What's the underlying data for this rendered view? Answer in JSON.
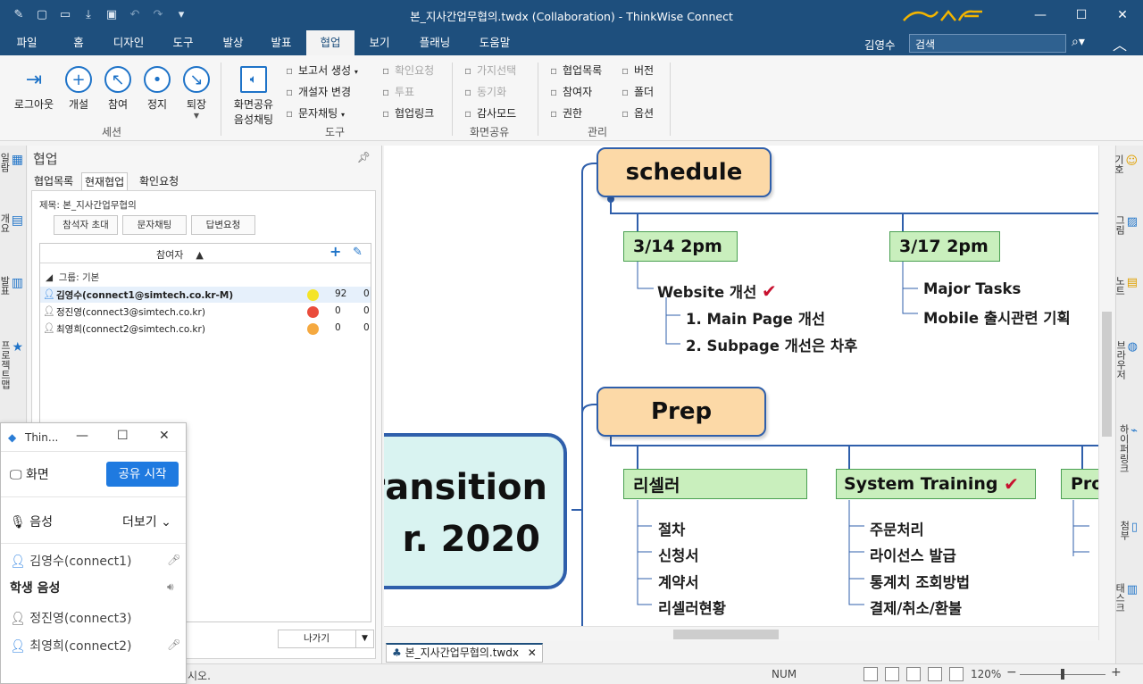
{
  "window": {
    "title": "본_지사간업무협의.twdx (Collaboration) - ThinkWise Connect",
    "minimize": "—",
    "maximize": "☐",
    "close": "✕"
  },
  "menu": {
    "tabs": [
      "파일",
      "홈",
      "디자인",
      "도구",
      "발상",
      "발표",
      "협업",
      "보기",
      "플래닝",
      "도움말"
    ],
    "active": "협업",
    "user": "김영수",
    "search_placeholder": "검색"
  },
  "ribbon": {
    "session": {
      "label": "세션",
      "buttons": [
        "로그아웃",
        "개설",
        "참여",
        "정지",
        "퇴장"
      ]
    },
    "tools": {
      "label": "도구",
      "screen_share_1": "화면공유",
      "screen_share_2": "음성채팅",
      "items": [
        {
          "text": "보고서 생성",
          "enabled": true,
          "dropdown": true
        },
        {
          "text": "개설자 변경",
          "enabled": true
        },
        {
          "text": "문자채팅",
          "enabled": true,
          "dropdown": true
        },
        {
          "text": "확인요청",
          "enabled": false
        },
        {
          "text": "투표",
          "enabled": false
        },
        {
          "text": "협업링크",
          "enabled": true
        }
      ]
    },
    "screenshare": {
      "label": "화면공유",
      "items": [
        {
          "text": "가지선택",
          "enabled": false
        },
        {
          "text": "동기화",
          "enabled": false
        },
        {
          "text": "감사모드",
          "enabled": true
        }
      ]
    },
    "manage": {
      "label": "관리",
      "items": [
        "협업목록",
        "참여자",
        "권한",
        "버전",
        "폴더",
        "옵션"
      ]
    }
  },
  "left_rail": [
    "일람",
    "개요",
    "발표",
    "프로젝트맵"
  ],
  "panel": {
    "title": "협업",
    "tabs": [
      "협업목록",
      "현재협업",
      "확인요청"
    ],
    "active_tab": "현재협업",
    "subject": "제목: 본_지사간업무협의",
    "buttons": [
      "참석자 초대",
      "문자채팅",
      "답변요청"
    ],
    "grid_header": "참여자",
    "group": "그룹: 기본",
    "participants": [
      {
        "name": "김영수(connect1@simtech.co.kr-M)",
        "status_color": "#f4e427",
        "v1": "92",
        "v2": "0",
        "bold": true
      },
      {
        "name": "정진영(connect3@simtech.co.kr)",
        "status_color": "#ea4c3c",
        "v1": "0",
        "v2": "0",
        "bold": false
      },
      {
        "name": "최영희(connect2@simtech.co.kr)",
        "status_color": "#f5a940",
        "v1": "0",
        "v2": "0",
        "bold": false
      }
    ],
    "exit_button": "나가기"
  },
  "mini_window": {
    "title": "Thin...",
    "screen_label": "화면",
    "share_button": "공유 시작",
    "voice_label": "음성",
    "more_label": "더보기",
    "users": [
      {
        "name": "김영수(connect1)",
        "color": "#1f7ae0"
      },
      {
        "name": "정진영(connect3)",
        "color": "#555555"
      },
      {
        "name": "최영희(connect2)",
        "color": "#1f7ae0"
      }
    ],
    "student_voice": "학생 음성"
  },
  "map": {
    "central_line1": "Transition",
    "central_line2": "r. 2020",
    "topic1": "schedule",
    "topic1_sub1": "3/14 2pm",
    "topic1_sub1_leaf": "Website 개선",
    "topic1_sub1_children": [
      "1. Main Page 개선",
      "2. Subpage 개선은 차후"
    ],
    "topic1_sub2": "3/17 2pm",
    "topic1_sub2_leaves": [
      "Major Tasks",
      "Mobile 출시관련 기획"
    ],
    "topic2": "Prep",
    "topic2_sub1": "리셀러",
    "topic2_sub1_leaves": [
      "절차",
      "신청서",
      "계약서",
      "리셀러현황"
    ],
    "topic2_sub2": "System Training",
    "topic2_sub2_leaves": [
      "주문처리",
      "라이선스 발급",
      "통계치 조회방법",
      "결제/취소/환불"
    ],
    "topic2_sub3": "Pro",
    "check_mark": "✔"
  },
  "doc_tab": "본_지사간업무협의.twdx",
  "right_rail": [
    "기호",
    "그림",
    "노트",
    "브라우저",
    "하이퍼링크",
    "첨부",
    "태스크"
  ],
  "status": {
    "message": "시오.",
    "num": "NUM",
    "zoom": "120%"
  },
  "colors": {
    "titlebar": "#1e4f7d",
    "topic_fill": "#fcd9a7",
    "subtopic_fill": "#c9efbd",
    "line": "#2f5fab",
    "accent": "#1f7ae0"
  }
}
